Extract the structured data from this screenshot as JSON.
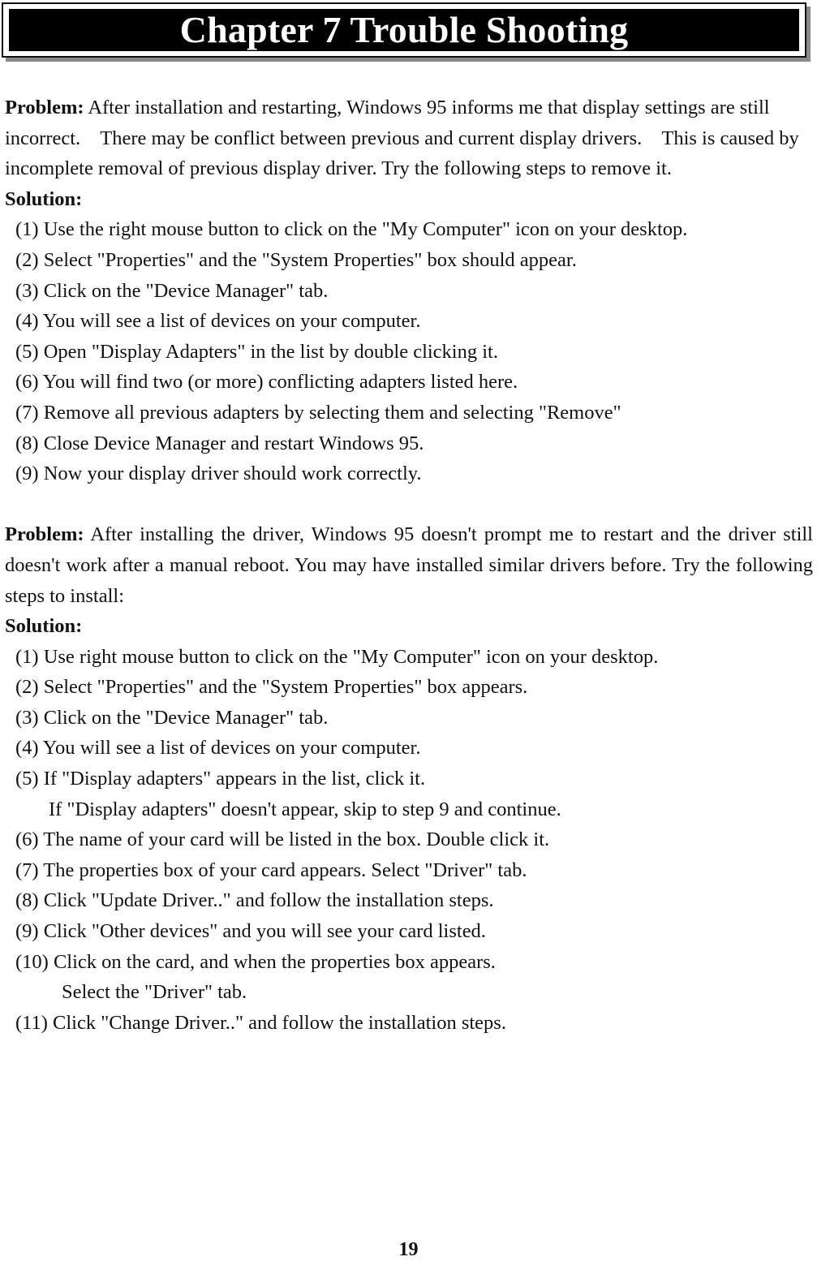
{
  "chapter_title": "Chapter 7 Trouble Shooting",
  "sections": [
    {
      "problem_label": "Problem:",
      "problem_text": "After installation and restarting, Windows 95 informs me that display settings are still incorrect.    There may be conflict between previous and current display drivers.    This is caused by incomplete removal of previous display driver. Try the following steps to remove it.",
      "solution_label": "Solution:",
      "steps": [
        {
          "text": "(1) Use the right mouse button to click on the \"My Computer\" icon on your desktop."
        },
        {
          "text": "(2) Select \"Properties\" and the \"System Properties\" box should appear."
        },
        {
          "text": "(3) Click on the \"Device Manager\" tab."
        },
        {
          "text": "(4) You will see a list of devices on your computer."
        },
        {
          "text": "(5) Open \"Display Adapters\" in the list by double clicking it."
        },
        {
          "text": "(6) You will find two (or more) conflicting adapters listed here."
        },
        {
          "text": "(7) Remove all previous adapters by selecting them and selecting \"Remove\""
        },
        {
          "text": "(8) Close Device Manager and restart Windows 95."
        },
        {
          "text": "(9) Now your display driver should work correctly."
        }
      ]
    },
    {
      "problem_label": "Problem:",
      "problem_text": "After installing the driver, Windows 95 doesn't prompt me to restart and the driver still doesn't work after a manual reboot.    You may have installed similar drivers before. Try the following steps to install:",
      "solution_label": "Solution:",
      "steps": [
        {
          "text": "(1) Use right mouse button to click on the \"My Computer\" icon on your desktop."
        },
        {
          "text": "(2) Select \"Properties\" and the \"System Properties\" box appears."
        },
        {
          "text": "(3) Click on the \"Device Manager\" tab."
        },
        {
          "text": "(4) You will see a list of devices on your computer."
        },
        {
          "text": "(5) If \"Display adapters\" appears in the list, click it.",
          "continuation": "If \"Display adapters\" doesn't appear, skip to step 9 and continue."
        },
        {
          "text": "(6) The name of your card will be listed in the box. Double click it."
        },
        {
          "text": "(7) The properties box of your card appears. Select \"Driver\" tab."
        },
        {
          "text": "(8) Click \"Update Driver..\" and follow the installation steps."
        },
        {
          "text": "(9) Click \"Other devices\" and you will see your card listed."
        },
        {
          "text": "(10) Click on the card, and when the properties box appears.",
          "continuation": "Select the \"Driver\" tab."
        },
        {
          "text": "(11) Click \"Change Driver..\" and follow the installation steps."
        }
      ]
    }
  ],
  "page_number": "19"
}
